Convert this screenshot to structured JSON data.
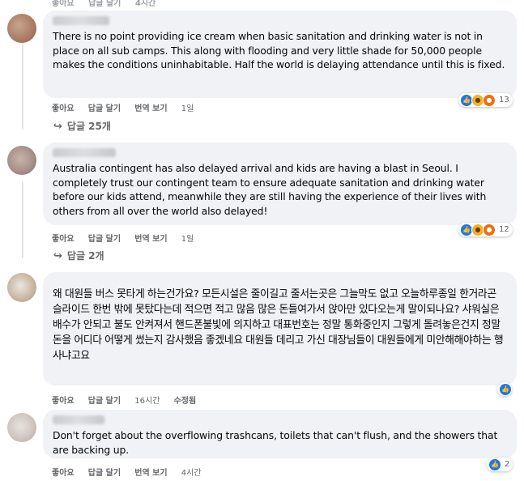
{
  "top_actions": {
    "like": "좋아요",
    "reply": "답글 달기",
    "time": "4시간"
  },
  "comments": [
    {
      "text": "There is no point providing ice cream when basic sanitation and drinking water is not in place on all sub camps. This along with flooding and very little shade for 50,000 people makes the conditions uninhabitable. Half the world is delaying attendance until this is fixed.",
      "actions": {
        "like": "좋아요",
        "reply": "답글 달기",
        "translate": "번역 보기",
        "time": "1일"
      },
      "reactions": {
        "icons": [
          "like-icon",
          "care-icon",
          "angry-icon"
        ],
        "count": "13"
      },
      "replies": "답글 25개"
    },
    {
      "text": "Australia contingent has also delayed arrival and kids are having a blast in Seoul. I completely trust our contingent team to ensure adequate sanitation and drinking water before our kids attend, meanwhile they are still having the experience of their lives with others from all over the world also delayed!",
      "actions": {
        "like": "좋아요",
        "reply": "답글 달기",
        "translate": "번역 보기",
        "time": "1일"
      },
      "reactions": {
        "icons": [
          "like-icon",
          "sad-icon",
          "angry-icon"
        ],
        "count": "12"
      },
      "replies": "답글 2개"
    },
    {
      "text": "왜 대원들 버스 못타게 하는건가요? 모든시설은 줄이길고 줄서는곳은 그늘막도 없고 오늘하루종일 한거라곤 슬라이드 한번 밖에 못탔다는데 적으면 적고 많음 많은 돈들여가서 앉아만 있다오는게 말이되나요? 샤워실은 배수가 안되고 불도 안켜져서 핸드폰불빛에 의지하고 대표번호는 정말 통화중인지 그렇게 돌려놓은건지 정말 돈을 어디다 어떻게 썼는지 감사했음 좋겠네요 대원들 데리고 가신 대장님들이 대원들에게 미안해해야하는 행사냐고요",
      "actions": {
        "like": "좋아요",
        "reply": "답글 달기",
        "time": "16시간",
        "edited": "수정됨"
      },
      "reactions": {
        "icons": [
          "like-icon"
        ],
        "count": ""
      }
    },
    {
      "text": "Don't forget about the overflowing trashcans, toilets that can't flush, and the showers that are backing up.",
      "actions": {
        "like": "좋아요",
        "reply": "답글 달기",
        "translate": "번역 보기",
        "time": "4시간"
      },
      "reactions": {
        "icons": [
          "like-icon"
        ],
        "count": "2"
      }
    }
  ]
}
